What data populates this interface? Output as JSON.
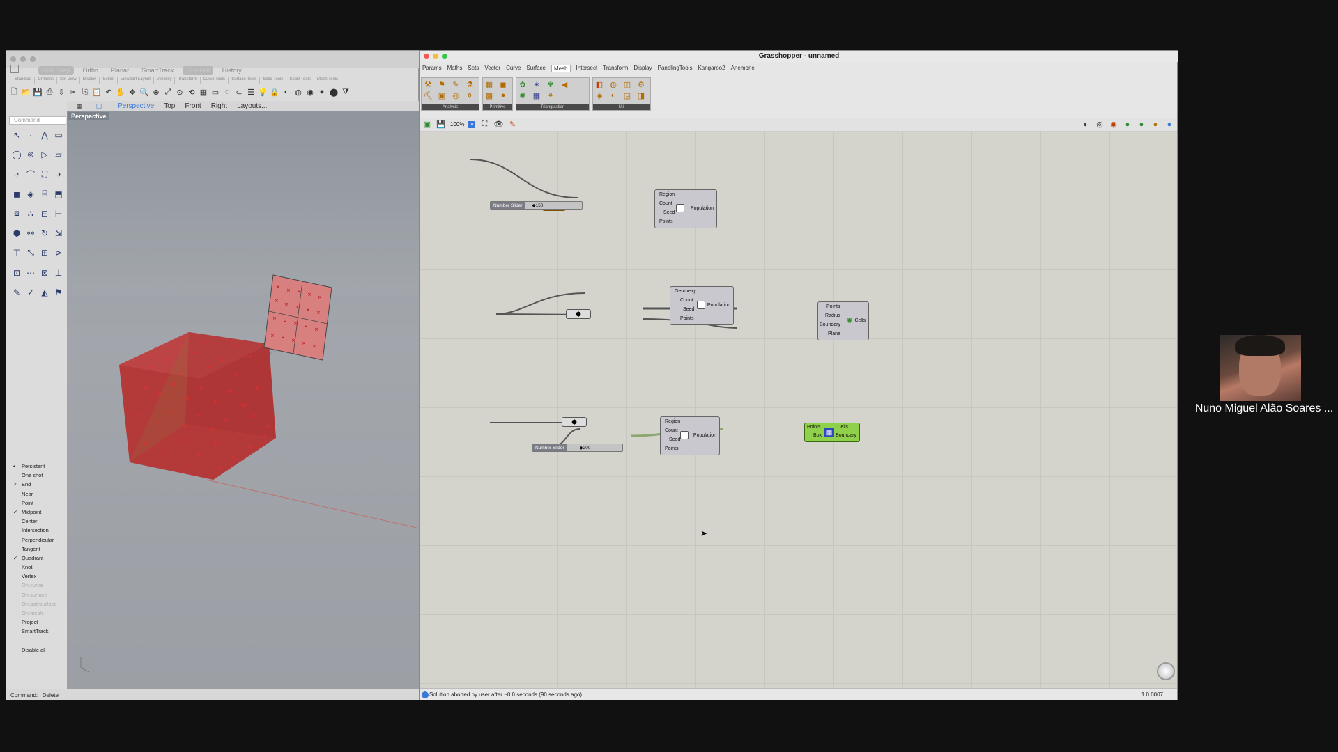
{
  "rhino": {
    "modes": [
      "Grid Snap",
      "Ortho",
      "Planar",
      "SmartTrack",
      "Gumball",
      "History"
    ],
    "tool_tabs": [
      "Standard",
      "CPlanes",
      "Set View",
      "Display",
      "Select",
      "Viewport Layout",
      "Visibility",
      "Transform",
      "Curve Tools",
      "Surface Tools",
      "Solid Tools",
      "SubD Tools",
      "Mesh Tools"
    ],
    "command_placeholder": "Command",
    "view_tabs": [
      "Perspective",
      "Top",
      "Front",
      "Right",
      "Layouts..."
    ],
    "viewport_label": "Perspective",
    "osnaps": [
      {
        "label": "Persistent",
        "mark": "•",
        "disabled": false
      },
      {
        "label": "One shot",
        "mark": "",
        "disabled": false
      },
      {
        "label": "End",
        "mark": "✓",
        "disabled": false
      },
      {
        "label": "Near",
        "mark": "",
        "disabled": false
      },
      {
        "label": "Point",
        "mark": "",
        "disabled": false
      },
      {
        "label": "Midpoint",
        "mark": "✓",
        "disabled": false
      },
      {
        "label": "Center",
        "mark": "",
        "disabled": false
      },
      {
        "label": "Intersection",
        "mark": "",
        "disabled": false
      },
      {
        "label": "Perpendicular",
        "mark": "",
        "disabled": false
      },
      {
        "label": "Tangent",
        "mark": "",
        "disabled": false
      },
      {
        "label": "Quadrant",
        "mark": "✓",
        "disabled": false
      },
      {
        "label": "Knot",
        "mark": "",
        "disabled": false
      },
      {
        "label": "Vertex",
        "mark": "",
        "disabled": false
      },
      {
        "label": "On curve",
        "mark": "",
        "disabled": true
      },
      {
        "label": "On surface",
        "mark": "",
        "disabled": true
      },
      {
        "label": "On polysurface",
        "mark": "",
        "disabled": true
      },
      {
        "label": "On mesh",
        "mark": "",
        "disabled": true
      },
      {
        "label": "Project",
        "mark": "",
        "disabled": false
      },
      {
        "label": "SmartTrack",
        "mark": "",
        "disabled": false
      },
      {
        "label": "",
        "mark": "",
        "disabled": false
      },
      {
        "label": "Disable all",
        "mark": "",
        "disabled": false
      }
    ],
    "status": "Command: _Delete"
  },
  "gh": {
    "title": "Grasshopper - unnamed",
    "menu": [
      "Params",
      "Maths",
      "Sets",
      "Vector",
      "Curve",
      "Surface",
      "Mesh",
      "Intersect",
      "Transform",
      "Display",
      "PanelingTools",
      "Kangaroo2",
      "Anemone"
    ],
    "active_menu": "Mesh",
    "ribbon_groups": [
      "Analysis",
      "Primitive",
      "Triangulation",
      "Util"
    ],
    "zoom": "100%",
    "status": "Solution aborted by user after ~0.0 seconds (90 seconds ago)",
    "version": "1.0.0007",
    "components": {
      "pop1": {
        "inputs": [
          "Region",
          "Count",
          "Seed",
          "Points"
        ],
        "output": "Population"
      },
      "pop2": {
        "inputs": [
          "Geometry",
          "Count",
          "Seed",
          "Points"
        ],
        "output": "Population"
      },
      "pop3": {
        "inputs": [
          "Region",
          "Count",
          "Seed",
          "Points"
        ],
        "output": "Population"
      },
      "voronoi3d": {
        "inputs": [
          "Points",
          "Radius",
          "Boundary",
          "Plane"
        ],
        "output": "Cells"
      },
      "voronoi_green": {
        "inputs": [
          "Points",
          "Box"
        ],
        "outputs": [
          "Cells",
          "Boundary"
        ]
      }
    },
    "sliders": [
      {
        "label": "Number Slider",
        "value": "◆150"
      },
      {
        "label": "Number Slider",
        "value": "◆200"
      }
    ]
  },
  "webcam": {
    "name": "Nuno Miguel Alão Soares ..."
  }
}
